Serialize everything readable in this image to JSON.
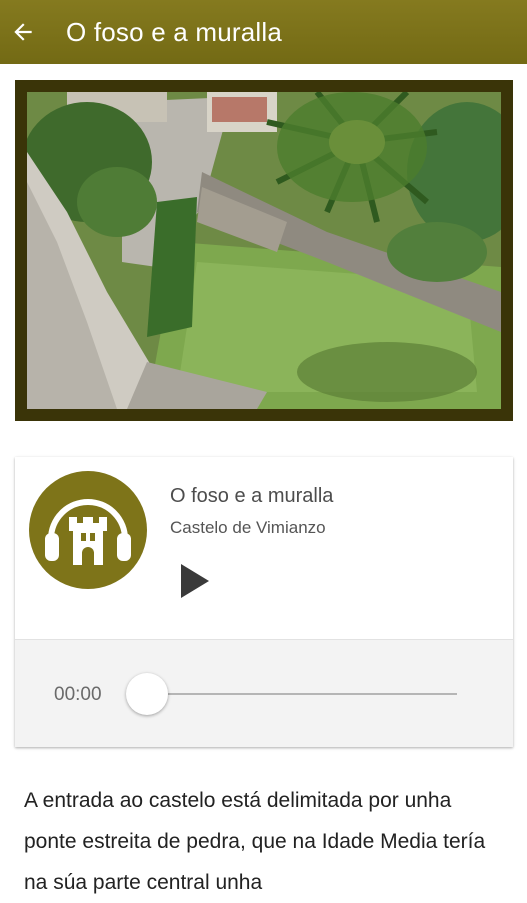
{
  "header": {
    "title": "O foso e a muralla",
    "back_icon": "arrow-back-icon",
    "background": "#7e7419"
  },
  "photo": {
    "alt_icon": "photo-gallery-icon"
  },
  "player": {
    "logo_icon": "castle-headphones-icon",
    "logo_color": "#7e7419",
    "track_title": "O foso e a muralla",
    "track_subtitle": "Castelo de Vimianzo",
    "play_icon": "play-icon",
    "current_time": "00:00",
    "progress": 0
  },
  "description": {
    "text": "A entrada ao castelo está delimitada por unha ponte estreita de pedra, que na Idade Media tería na súa parte central unha"
  }
}
